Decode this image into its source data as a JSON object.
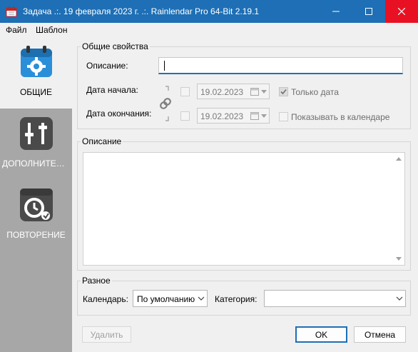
{
  "window": {
    "title": "Задача .:. 19 февраля 2023 г. .:. Rainlendar Pro 64-Bit 2.19.1"
  },
  "menu": {
    "items": [
      "Файл",
      "Шаблон"
    ]
  },
  "sidebar": {
    "items": [
      {
        "label": "ОБЩИЕ",
        "icon": "calendar-gear-icon",
        "active": true
      },
      {
        "label": "ДОПОЛНИТЕЛЬНО",
        "icon": "sliders-icon",
        "active": false
      },
      {
        "label": "ПОВТОРЕНИЕ",
        "icon": "repeat-clock-icon",
        "active": false
      }
    ]
  },
  "general": {
    "group_title": "Общие свойства",
    "description_label": "Описание:",
    "description_value": "",
    "start_label": "Дата начала:",
    "end_label": "Дата окончания:",
    "start_date": "19.02.2023",
    "end_date": "19.02.2023",
    "date_only_label": "Только дата",
    "date_only_checked": true,
    "show_in_calendar_label": "Показывать в календаре",
    "show_in_calendar_checked": false
  },
  "description_section": {
    "group_title": "Описание",
    "text": ""
  },
  "misc": {
    "group_title": "Разное",
    "calendar_label": "Календарь:",
    "calendar_value": "По умолчанию",
    "category_label": "Категория:",
    "category_value": ""
  },
  "buttons": {
    "delete": "Удалить",
    "ok": "OK",
    "cancel": "Отмена"
  },
  "colors": {
    "titlebar": "#1e6fb5",
    "close": "#e81123",
    "sidebar": "#a7a7a7",
    "accent": "#1e6fb5"
  }
}
